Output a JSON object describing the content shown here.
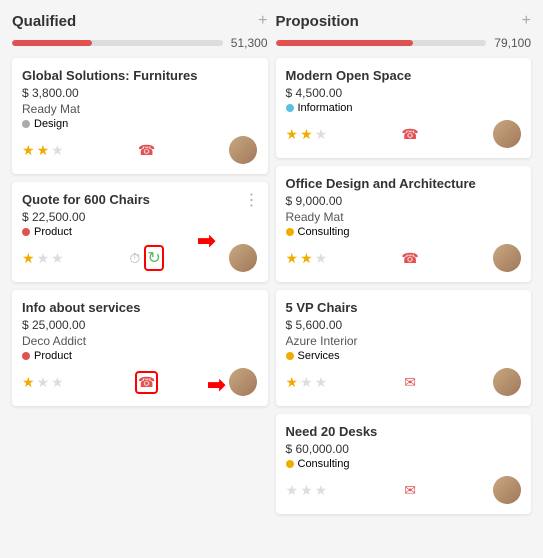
{
  "columns": [
    {
      "id": "qualified",
      "title": "Qualified",
      "add_label": "+",
      "progress_pct": 38,
      "progress_color": "#e05252",
      "amount": "51,300",
      "cards": [
        {
          "id": "card-1",
          "title": "Global Solutions: Furnitures",
          "amount": "$ 3,800.00",
          "company": "Ready Mat",
          "tag": "Design",
          "tag_type": "design",
          "stars": 2,
          "max_stars": 3,
          "action": "phone",
          "highlighted": false,
          "has_menu": false
        },
        {
          "id": "card-2",
          "title": "Quote for 600 Chairs",
          "amount": "$ 22,500.00",
          "company": null,
          "tag": "Product",
          "tag_type": "product",
          "stars": 1,
          "max_stars": 3,
          "action": "refresh",
          "highlighted": true,
          "has_menu": true
        },
        {
          "id": "card-3",
          "title": "Info about services",
          "amount": "$ 25,000.00",
          "company": "Deco Addict",
          "tag": "Product",
          "tag_type": "product",
          "stars": 1,
          "max_stars": 3,
          "action": "phone",
          "highlighted": true,
          "has_menu": false
        }
      ]
    },
    {
      "id": "proposition",
      "title": "Proposition",
      "add_label": "+",
      "progress_pct": 65,
      "progress_color": "#e05252",
      "amount": "79,100",
      "cards": [
        {
          "id": "card-4",
          "title": "Modern Open Space",
          "amount": "$ 4,500.00",
          "company": null,
          "tag": "Information",
          "tag_type": "information",
          "stars": 2,
          "max_stars": 3,
          "action": "phone",
          "highlighted": false,
          "has_menu": false
        },
        {
          "id": "card-5",
          "title": "Office Design and Architecture",
          "amount": "$ 9,000.00",
          "company": "Ready Mat",
          "tag": "Consulting",
          "tag_type": "consulting",
          "stars": 2,
          "max_stars": 3,
          "action": "phone",
          "highlighted": false,
          "has_menu": false
        },
        {
          "id": "card-6",
          "title": "5 VP Chairs",
          "amount": "$ 5,600.00",
          "company": "Azure Interior",
          "tag": "Services",
          "tag_type": "services",
          "stars": 1,
          "max_stars": 3,
          "action": "email",
          "highlighted": false,
          "has_menu": false
        },
        {
          "id": "card-7",
          "title": "Need 20 Desks",
          "amount": "$ 60,000.00",
          "company": null,
          "tag": "Consulting",
          "tag_type": "consulting",
          "stars": 0,
          "max_stars": 3,
          "action": "email",
          "highlighted": false,
          "has_menu": false
        }
      ]
    }
  ]
}
